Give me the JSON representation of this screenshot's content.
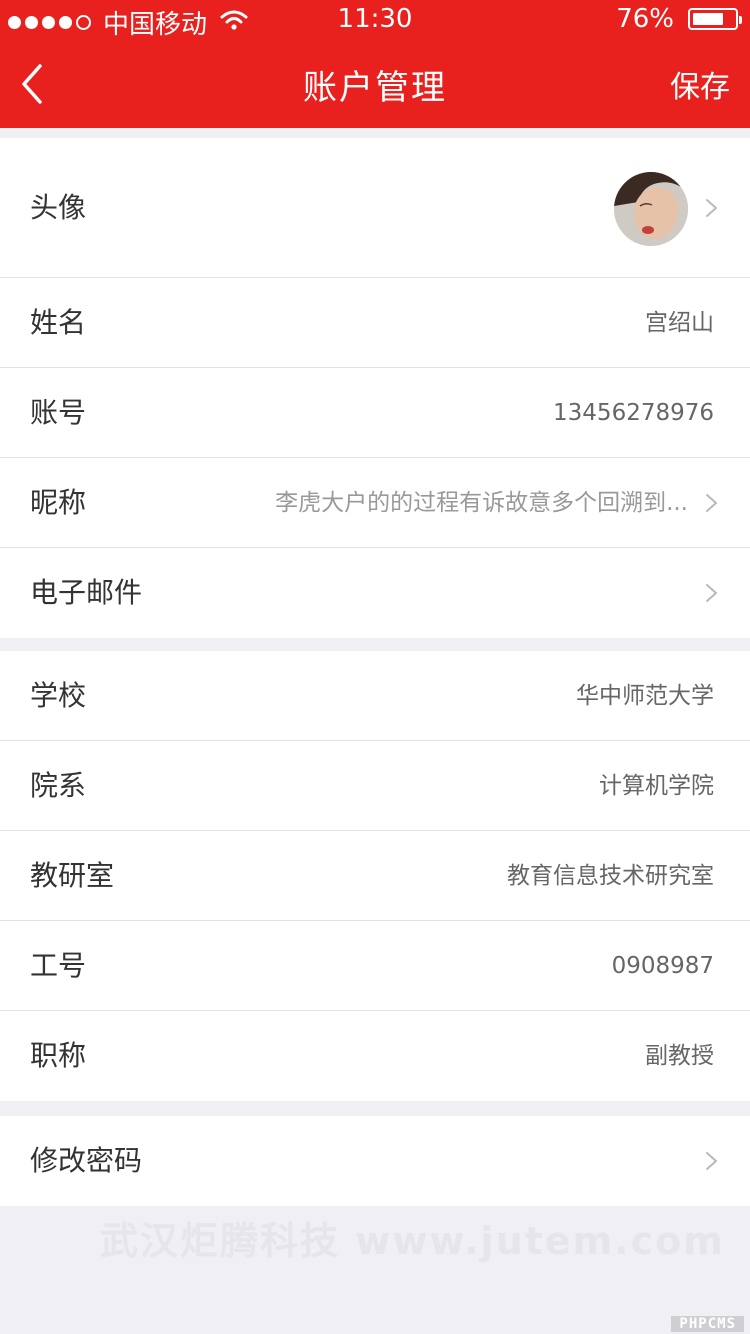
{
  "status_bar": {
    "carrier": "中国移动",
    "time": "11:30",
    "battery": "76%",
    "battery_level": 0.76,
    "signal_bars": 4
  },
  "nav": {
    "title": "账户管理",
    "save_label": "保存"
  },
  "profile": {
    "avatar_label": "头像",
    "name_label": "姓名",
    "name_value": "宫绍山",
    "account_label": "账号",
    "account_value": "13456278976",
    "nickname_label": "昵称",
    "nickname_value": "李虎大户的的过程有诉故意多个回溯到...",
    "email_label": "电子邮件"
  },
  "work": {
    "school_label": "学校",
    "school_value": "华中师范大学",
    "department_label": "院系",
    "department_value": "计算机学院",
    "office_label": "教研室",
    "office_value": "教育信息技术研究室",
    "staff_id_label": "工号",
    "staff_id_value": "0908987",
    "title_label": "职称",
    "title_value": "副教授"
  },
  "security": {
    "change_password_label": "修改密码"
  },
  "watermark": "武汉炬腾科技 www.jutem.com",
  "corner_logo": "PHPCMS",
  "colors": {
    "accent": "#e8211f",
    "background": "#efeff4"
  }
}
